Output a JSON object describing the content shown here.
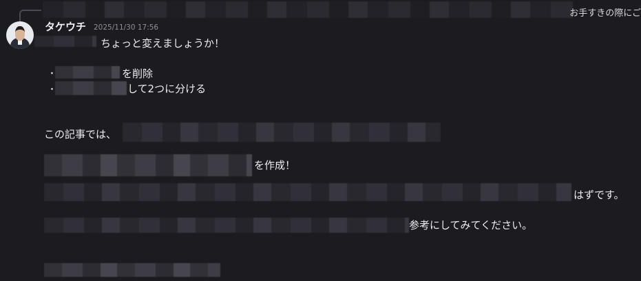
{
  "reply": {
    "preview_text": "お手すきの際にご"
  },
  "message": {
    "author": "タケウチ",
    "timestamp": "2025/11/30 17:56",
    "lines": {
      "l1": "ちょっと変えましょうか！",
      "b1_bullet": "・",
      "b1_text": "を削除",
      "b2_bullet": "・",
      "b2_text": "して2つに分ける",
      "l4": "この記事では、",
      "l5": "を作成！",
      "l6": "はずです。",
      "l7": "参考にしてみてください。"
    }
  }
}
